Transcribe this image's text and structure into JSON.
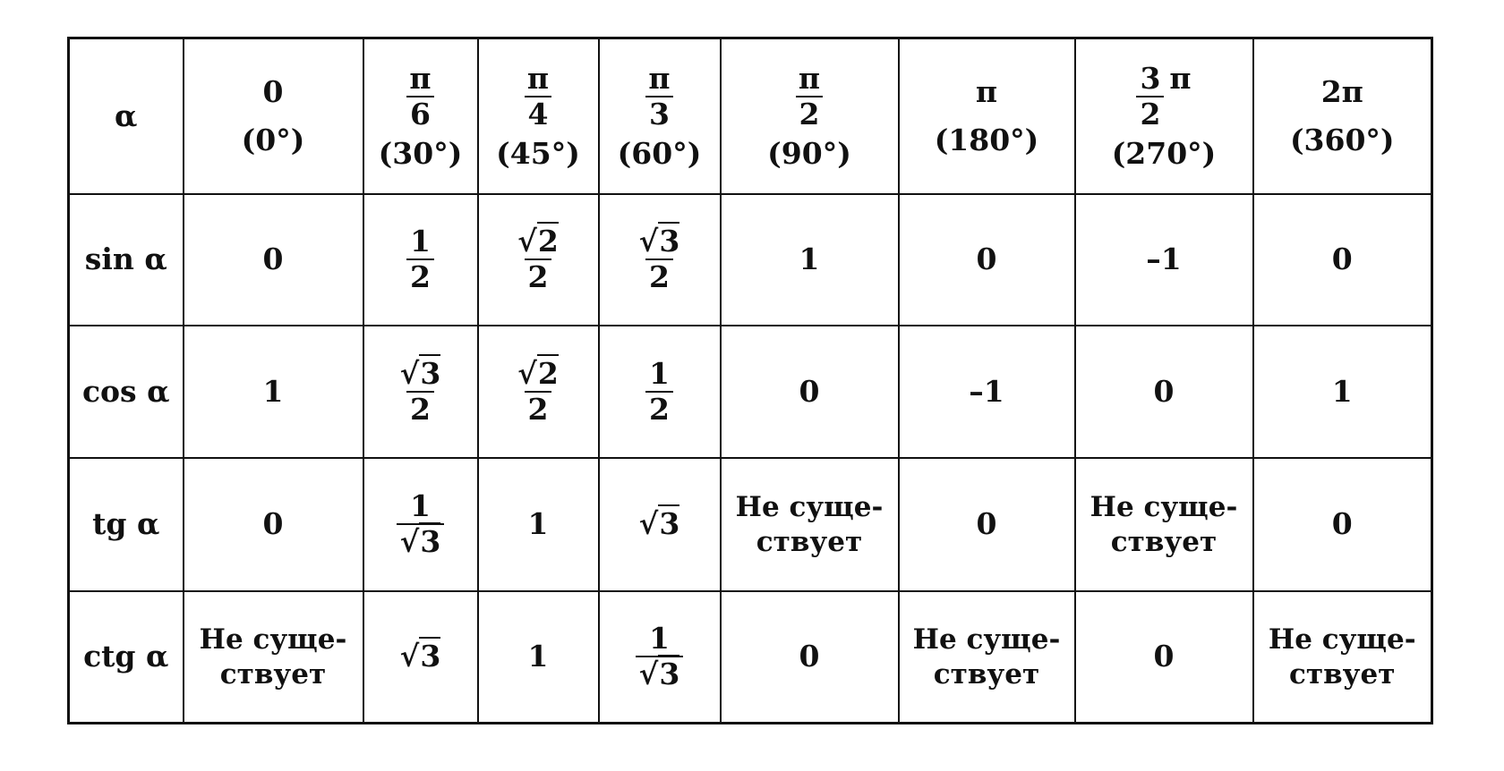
{
  "header": {
    "label": "α",
    "columns": [
      {
        "top": "0",
        "deg": "(0°)"
      },
      {
        "num": "π",
        "den": "6",
        "deg": "(30°)"
      },
      {
        "num": "π",
        "den": "4",
        "deg": "(45°)"
      },
      {
        "num": "π",
        "den": "3",
        "deg": "(60°)"
      },
      {
        "num": "π",
        "den": "2",
        "deg": "(90°)"
      },
      {
        "top": "π",
        "deg": "(180°)"
      },
      {
        "num": "3",
        "den": "2",
        "suffix": "π",
        "deg": "(270°)"
      },
      {
        "top": "2π",
        "deg": "(360°)"
      }
    ]
  },
  "rows": [
    {
      "label": "sin α",
      "values": [
        "0",
        "1/2",
        "√2/2",
        "√3/2",
        "1",
        "0",
        "–1",
        "0"
      ]
    },
    {
      "label": "cos α",
      "values": [
        "1",
        "√3/2",
        "√2/2",
        "1/2",
        "0",
        "–1",
        "0",
        "1"
      ]
    },
    {
      "label": "tg α",
      "values": [
        "0",
        "1/√3",
        "1",
        "√3",
        "Не суще-|ствует",
        "0",
        "Не суще-|ствует",
        "0"
      ]
    },
    {
      "label": "ctg α",
      "values": [
        "Не суще-|ствует",
        "√3",
        "1",
        "1/√3",
        "0",
        "Не суще-|ствует",
        "0",
        "Не суще-|ствует"
      ]
    }
  ]
}
